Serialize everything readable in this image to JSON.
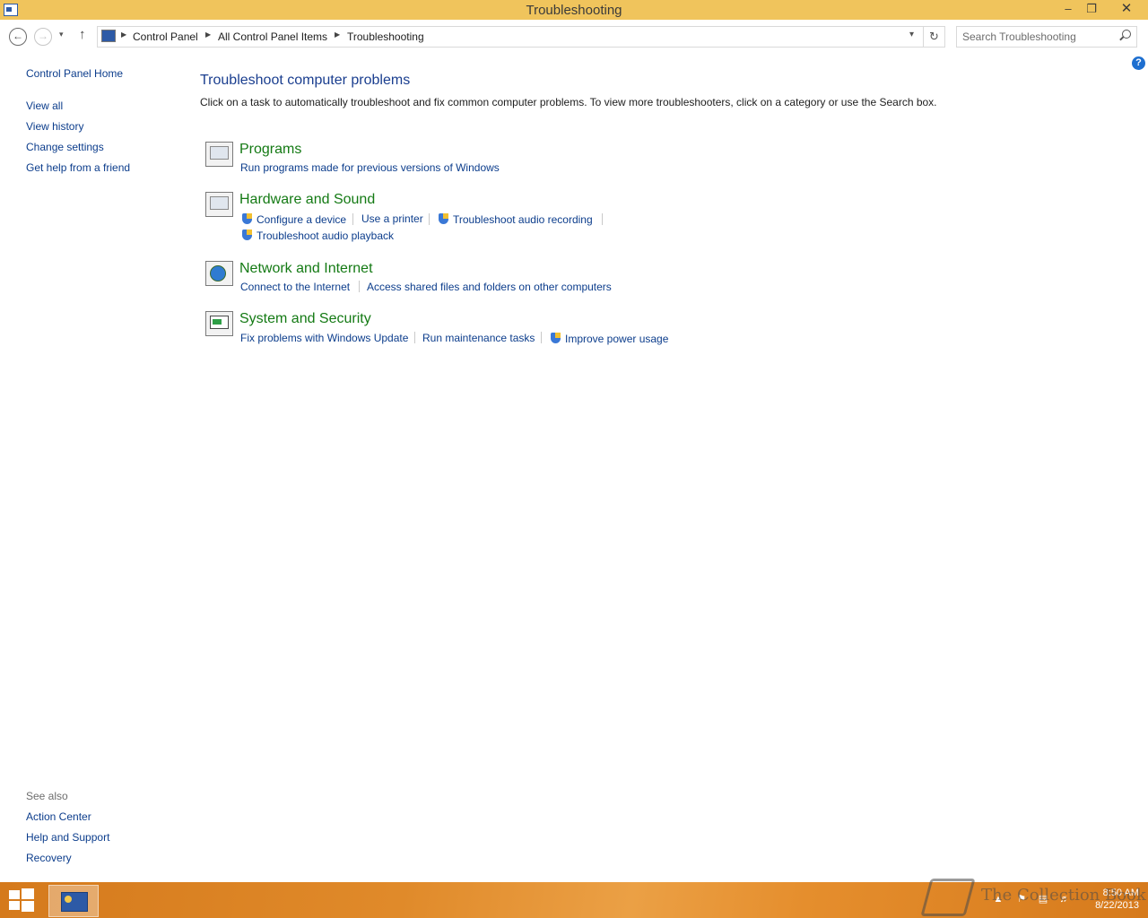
{
  "window": {
    "title": "Troubleshooting",
    "min_glyph": "–",
    "max_glyph": "❐",
    "close_glyph": "✕"
  },
  "nav": {
    "back_glyph": "←",
    "forward_glyph": "→",
    "history_glyph": "▾",
    "up_glyph": "↑",
    "breadcrumbs": [
      "Control Panel",
      "All Control Panel Items",
      "Troubleshooting"
    ],
    "refresh_glyph": "↻",
    "search_placeholder": "Search Troubleshooting"
  },
  "sidebar": {
    "home": "Control Panel Home",
    "links": [
      "View all",
      "View history",
      "Change settings",
      "Get help from a friend"
    ],
    "see_also_header": "See also",
    "see_also": [
      "Action Center",
      "Help and Support",
      "Recovery"
    ]
  },
  "help_glyph": "?",
  "main": {
    "title": "Troubleshoot computer problems",
    "description": "Click on a task to automatically troubleshoot and fix common computer problems. To view more troubleshooters, click on a category or use the Search box.",
    "categories": [
      {
        "title": "Programs",
        "icon": "programs-icon",
        "tasks": [
          "Run programs made for previous versions of Windows"
        ]
      },
      {
        "title": "Hardware and Sound",
        "icon": "hardware-sound-icon",
        "tasks": [
          "Configure a device",
          "Use a printer",
          "Troubleshoot audio recording",
          "Troubleshoot audio playback"
        ]
      },
      {
        "title": "Network and Internet",
        "icon": "network-icon",
        "tasks": [
          "Connect to the Internet",
          "Access shared files and folders on other computers"
        ]
      },
      {
        "title": "System and Security",
        "icon": "system-security-icon",
        "tasks": [
          "Fix problems with Windows Update",
          "Run maintenance tasks",
          "Improve power usage"
        ]
      }
    ]
  },
  "taskbar": {
    "time": "8:50 AM",
    "date": "8/22/2013"
  },
  "watermark": "The Collection Book",
  "colors": {
    "titlebar": "#f0c45c",
    "link": "#0c3d8c",
    "category": "#147a14",
    "heading": "#1a3e8f",
    "taskbar": "#e08a2a"
  }
}
